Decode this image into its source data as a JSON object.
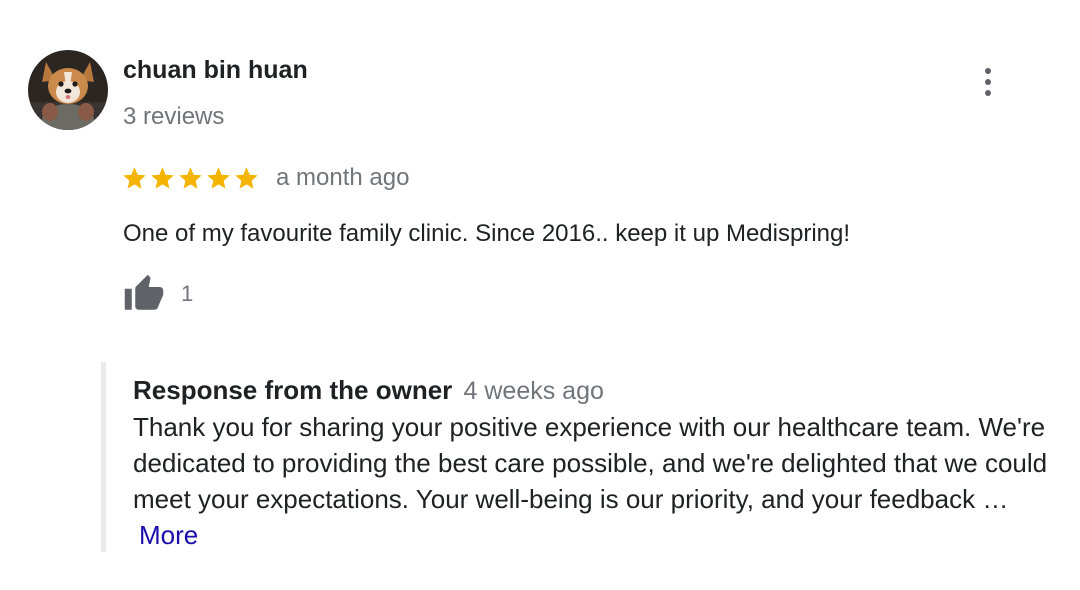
{
  "review": {
    "author": {
      "name": "chuan bin huan",
      "reviews_count": "3 reviews",
      "avatar": "dog-avatar-photo"
    },
    "menu_icon": "more-vert-icon",
    "rating": {
      "stars": 5,
      "max_stars": 5,
      "star_color": "#f4b400",
      "star_icon": "star-icon"
    },
    "timestamp": "a month ago",
    "text": "One of my favourite family clinic. Since 2016.. keep it up Medispring!",
    "likes": {
      "icon": "thumbs-up-icon",
      "count": "1"
    },
    "owner_response": {
      "title": "Response from the owner",
      "timestamp": "4 weeks ago",
      "text": "Thank you for sharing your positive experience with our healthcare team. We're dedicated to providing the best care possible, and we're delighted that we could meet your expectations. Your well-being is our priority, and your feedback …",
      "more_label": "More",
      "link_color": "#1a0dab"
    }
  }
}
